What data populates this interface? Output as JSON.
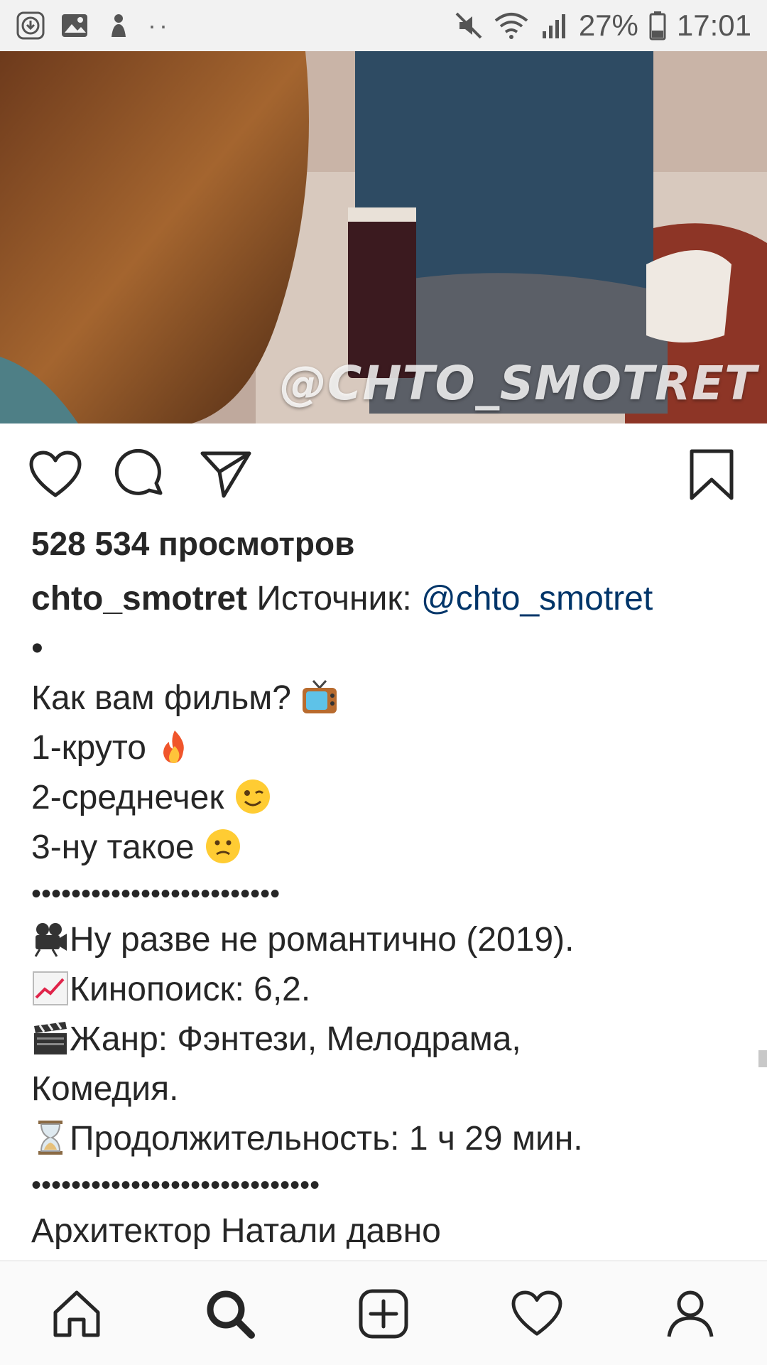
{
  "status_bar": {
    "battery": "27%",
    "time": "17:01",
    "left_dots": "··"
  },
  "video": {
    "watermark": "@CHTO_SMOTRET"
  },
  "post": {
    "views": "528 534 просмотров",
    "username": "chto_smotret",
    "source_label": "Источник:",
    "mention": "@chto_smotret",
    "bullet": "•",
    "q_line": "Как вам фильм?",
    "opt1": "1-круто",
    "opt2": "2-среднечек",
    "opt3": "3-ну такое",
    "dots1": "•••••••••••••••••••••••••",
    "film_line": "Ну разве не романтично (2019).",
    "kinopoisk_line": "Кинопоиск: 6,2.",
    "genre_line_a": "Жанр: Фэнтези, Мелодрама,",
    "genre_line_b": "Комедия.",
    "duration_line": "Продолжительность: 1 ч 29 мин.",
    "dots2": "•••••••••••••••••••••••••••••",
    "description_start": "Архитектор Натали давно"
  },
  "icons": {
    "like": "heart-icon",
    "comment": "comment-icon",
    "share": "send-icon",
    "save": "bookmark-icon",
    "home": "home-icon",
    "search": "search-icon",
    "add": "add-post-icon",
    "activity": "heart-icon",
    "profile": "profile-icon"
  },
  "colors": {
    "mention": "#003569",
    "text": "#262626",
    "statusbar_bg": "#f2f2f2"
  }
}
